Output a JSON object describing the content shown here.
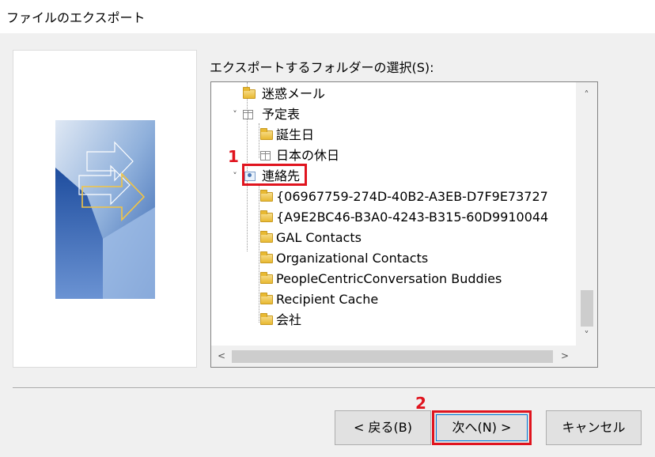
{
  "window": {
    "title": "ファイルのエクスポート"
  },
  "folder_select": {
    "label": "エクスポートするフォルダーの選択(S):"
  },
  "tree": [
    {
      "label": "迷惑メール",
      "icon": "folder-icon",
      "expander": "",
      "selected": false
    },
    {
      "label": "予定表",
      "icon": "calendar-icon",
      "expander": "˅",
      "selected": false
    },
    {
      "label": "誕生日",
      "icon": "folder-icon",
      "expander": "",
      "selected": false
    },
    {
      "label": "日本の休日",
      "icon": "calendar-icon",
      "expander": "",
      "selected": false
    },
    {
      "label": "連絡先",
      "icon": "contacts-icon",
      "expander": "˅",
      "selected": true
    },
    {
      "label": "{06967759-274D-40B2-A3EB-D7F9E73727",
      "icon": "folder-icon",
      "expander": "",
      "selected": false
    },
    {
      "label": "{A9E2BC46-B3A0-4243-B315-60D9910044",
      "icon": "folder-icon",
      "expander": "",
      "selected": false
    },
    {
      "label": "GAL Contacts",
      "icon": "folder-icon",
      "expander": "",
      "selected": false
    },
    {
      "label": "Organizational Contacts",
      "icon": "folder-icon",
      "expander": "",
      "selected": false
    },
    {
      "label": "PeopleCentricConversation Buddies",
      "icon": "folder-icon",
      "expander": "",
      "selected": false
    },
    {
      "label": "Recipient Cache",
      "icon": "folder-icon",
      "expander": "",
      "selected": false
    },
    {
      "label": "会社",
      "icon": "folder-icon",
      "expander": "",
      "selected": false
    }
  ],
  "scrollbar": {
    "up": "˄",
    "down": "˅",
    "left": "<",
    "right": ">"
  },
  "buttons": {
    "back": "< 戻る(B)",
    "next": "次へ(N) >",
    "cancel": "キャンセル"
  },
  "annotations": {
    "step1": "1",
    "step2": "2"
  },
  "colors": {
    "highlight": "#e0141e",
    "focus": "#0078d7"
  }
}
